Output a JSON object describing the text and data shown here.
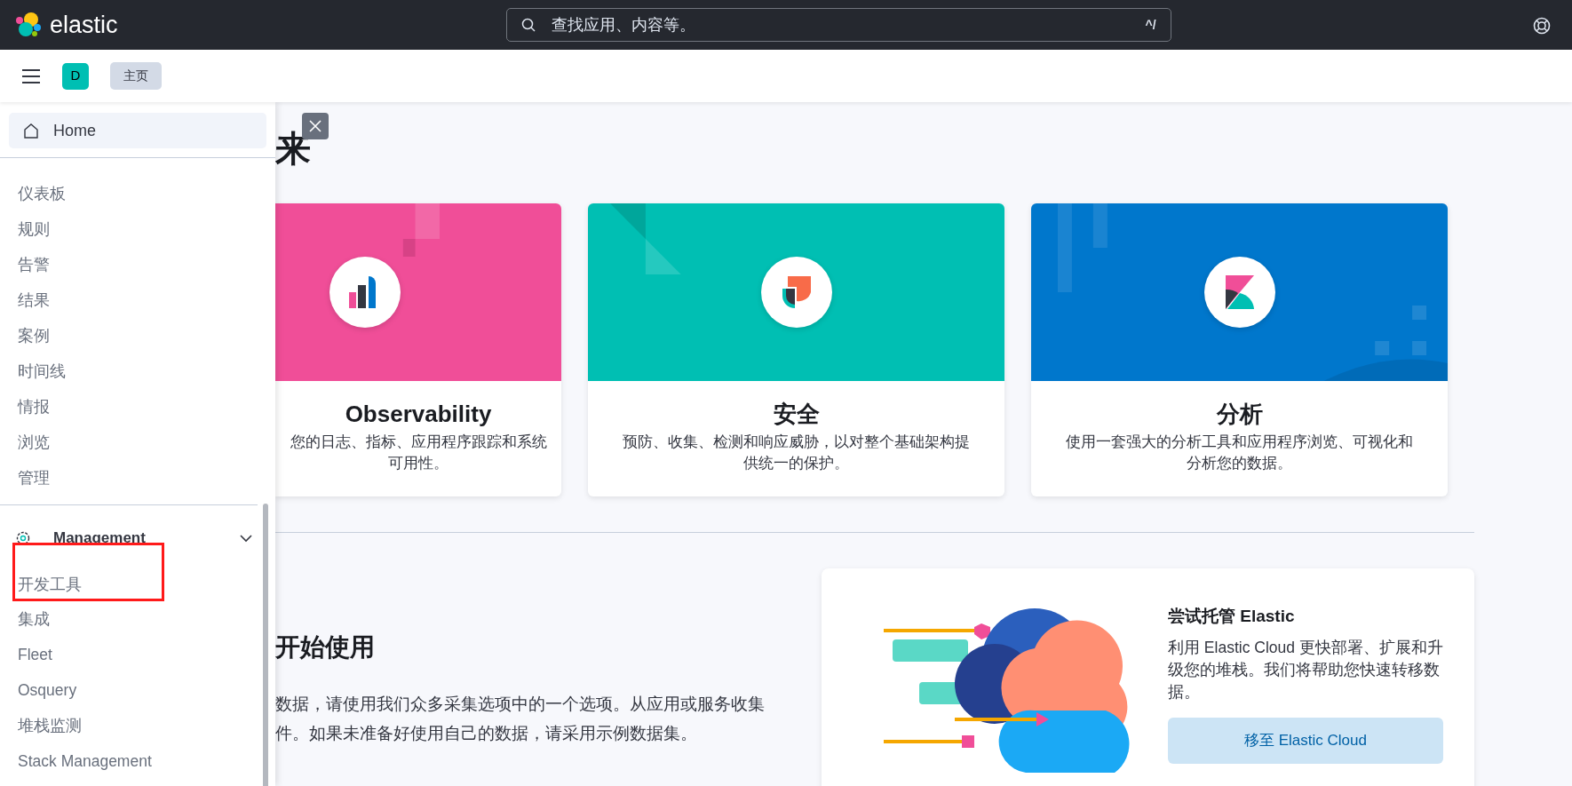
{
  "header": {
    "logo_text": "elastic",
    "search": {
      "placeholder": "查找应用、内容等。",
      "shortcut": "^/"
    }
  },
  "breadcrumb_bar": {
    "avatar": "D",
    "crumbs": [
      "主页"
    ]
  },
  "nav": {
    "home": "Home",
    "items": [
      "仪表板",
      "规则",
      "告警",
      "结果",
      "案例",
      "时间线",
      "情报",
      "浏览",
      "管理"
    ],
    "sections": [
      {
        "title": "Management",
        "expanded": true,
        "items": [
          {
            "label": "开发工具",
            "highlighted": true
          },
          {
            "label": "集成",
            "highlighted": false
          },
          {
            "label": "Fleet",
            "highlighted": false
          },
          {
            "label": "Osquery",
            "highlighted": false
          },
          {
            "label": "堆栈监测",
            "highlighted": false
          },
          {
            "label": "Stack Management",
            "highlighted": false
          }
        ]
      }
    ]
  },
  "main": {
    "title": "来",
    "solutions": [
      {
        "kind": "observability",
        "title": "Observability",
        "description": "您的日志、指标、应用程序跟踪和系统可用性。",
        "color": "#f04e98"
      },
      {
        "kind": "security",
        "title": "安全",
        "description": "预防、收集、检测和响应威胁，以对整个基础架构提供统一的保护。",
        "color": "#00bfb3"
      },
      {
        "kind": "analytics",
        "title": "分析",
        "description": "使用一套强大的分析工具和应用程序浏览、可视化和分析您的数据。",
        "color": "#0077cc"
      }
    ],
    "getting_started": {
      "title": "开始使用",
      "lines": [
        "数据，请使用我们众多采集选项中的一个选项。从应用或服务收集",
        "件。如果未准备好使用自己的数据，请采用示例数据集。"
      ]
    },
    "cloud": {
      "title": "尝试托管 Elastic",
      "description": "利用 Elastic Cloud 更快部署、扩展和升级您的堆栈。我们将帮助您快速转移数据。",
      "button": "移至 Elastic Cloud"
    }
  }
}
